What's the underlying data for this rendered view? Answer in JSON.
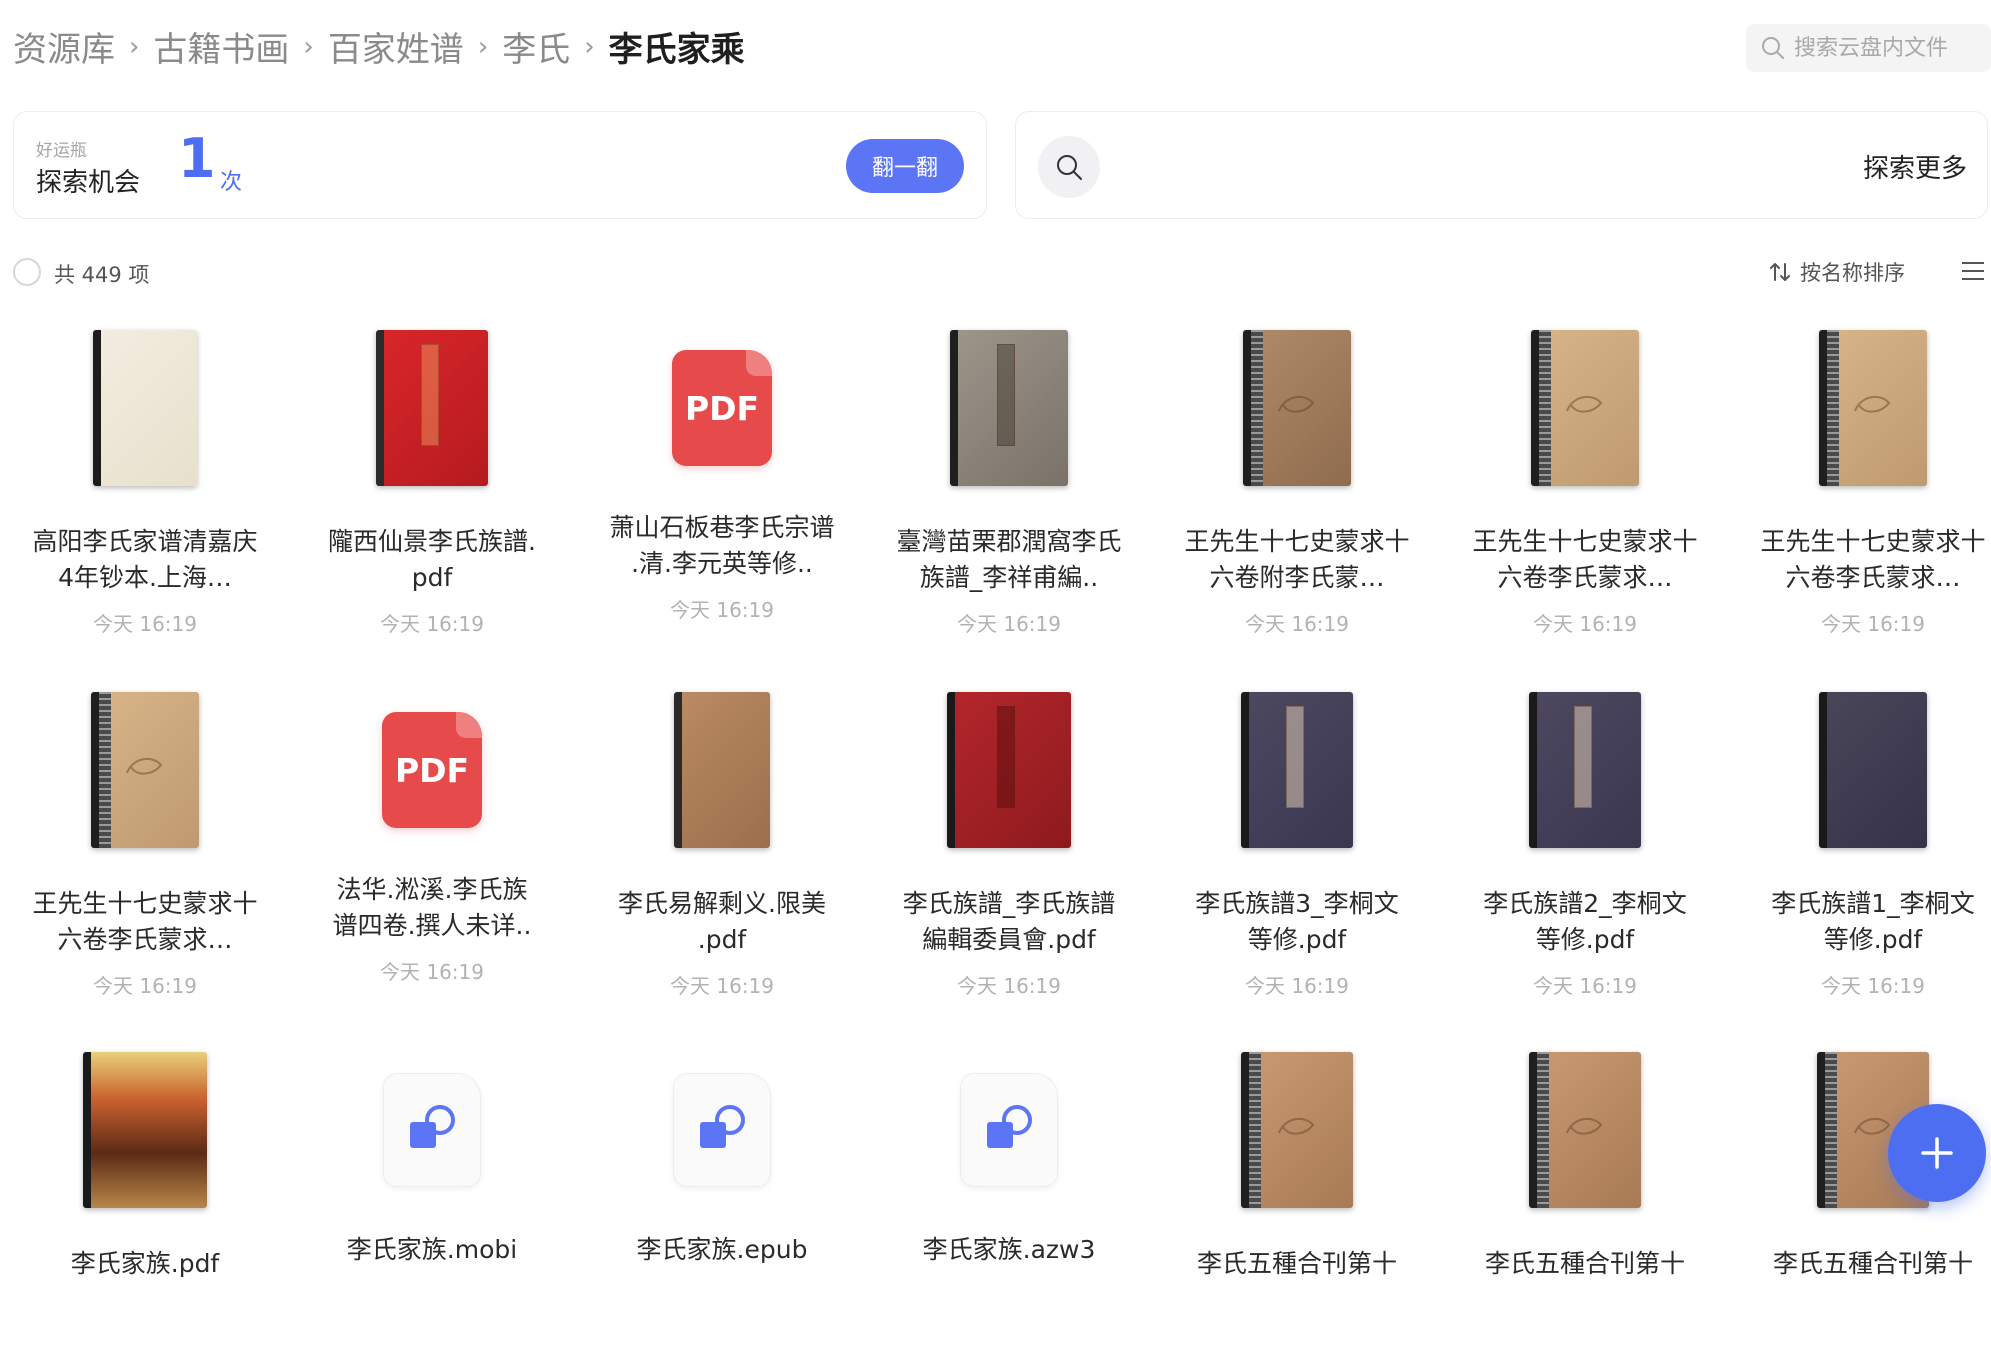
{
  "breadcrumb": {
    "items": [
      "资源库",
      "古籍书画",
      "百家姓谱",
      "李氏"
    ],
    "current": "李氏家乘"
  },
  "search": {
    "placeholder": "搜索云盘内文件"
  },
  "lucky_card": {
    "sub_label": "好运瓶",
    "label": "探索机会",
    "count": "1",
    "unit": "次",
    "button_label": "翻一翻"
  },
  "explore_card": {
    "label": "探索更多"
  },
  "toolbar": {
    "count_text": "共 449 项",
    "sort_label": "按名称排序"
  },
  "colors": {
    "accent": "#4e6ef2",
    "pdf_red": "#e64a4a"
  },
  "files": [
    {
      "name": "高阳李氏家谱清嘉庆4年钞本.上海…",
      "time": "今天 16:19",
      "thumb": "book-cream"
    },
    {
      "name": "隴西仙景李氏族譜.pdf",
      "time": "今天 16:19",
      "thumb": "book-red"
    },
    {
      "name": "萧山石板巷李氏宗谱.清.李元英等修..",
      "time": "今天 16:19",
      "thumb": "pdf-icon"
    },
    {
      "name": "臺灣苗栗郡潤窩李氏族譜_李祥甫編..",
      "time": "今天 16:19",
      "thumb": "book-grey"
    },
    {
      "name": "王先生十七史蒙求十六卷附李氏蒙…",
      "time": "今天 16:19",
      "thumb": "book-tan-dark"
    },
    {
      "name": "王先生十七史蒙求十六卷李氏蒙求…",
      "time": "今天 16:19",
      "thumb": "book-tan"
    },
    {
      "name": "王先生十七史蒙求十六卷李氏蒙求…",
      "time": "今天 16:19",
      "thumb": "book-tan"
    },
    {
      "name": "王先生十七史蒙求十六卷李氏蒙求…",
      "time": "今天 16:19",
      "thumb": "book-tan"
    },
    {
      "name": "法华.淞溪.李氏族谱四卷.撰人未详..",
      "time": "今天 16:19",
      "thumb": "pdf-icon"
    },
    {
      "name": "李氏易解剩义.限美.pdf",
      "time": "今天 16:19",
      "thumb": "book-brown"
    },
    {
      "name": "李氏族譜_李氏族譜編輯委員會.pdf",
      "time": "今天 16:19",
      "thumb": "book-red-dark"
    },
    {
      "name": "李氏族譜3_李桐文等修.pdf",
      "time": "今天 16:19",
      "thumb": "book-navy"
    },
    {
      "name": "李氏族譜2_李桐文等修.pdf",
      "time": "今天 16:19",
      "thumb": "book-navy"
    },
    {
      "name": "李氏族譜1_李桐文等修.pdf",
      "time": "今天 16:19",
      "thumb": "book-navy-plain"
    },
    {
      "name": "李氏家族.pdf",
      "time": "",
      "thumb": "book-poster"
    },
    {
      "name": "李氏家族.mobi",
      "time": "",
      "thumb": "ebook-icon"
    },
    {
      "name": "李氏家族.epub",
      "time": "",
      "thumb": "ebook-icon"
    },
    {
      "name": "李氏家族.azw3",
      "time": "",
      "thumb": "ebook-icon"
    },
    {
      "name": "李氏五種合刊第十",
      "time": "",
      "thumb": "book-brown-ruler"
    },
    {
      "name": "李氏五種合刊第十",
      "time": "",
      "thumb": "book-brown-ruler"
    },
    {
      "name": "李氏五種合刊第十",
      "time": "",
      "thumb": "book-brown-ruler"
    }
  ]
}
